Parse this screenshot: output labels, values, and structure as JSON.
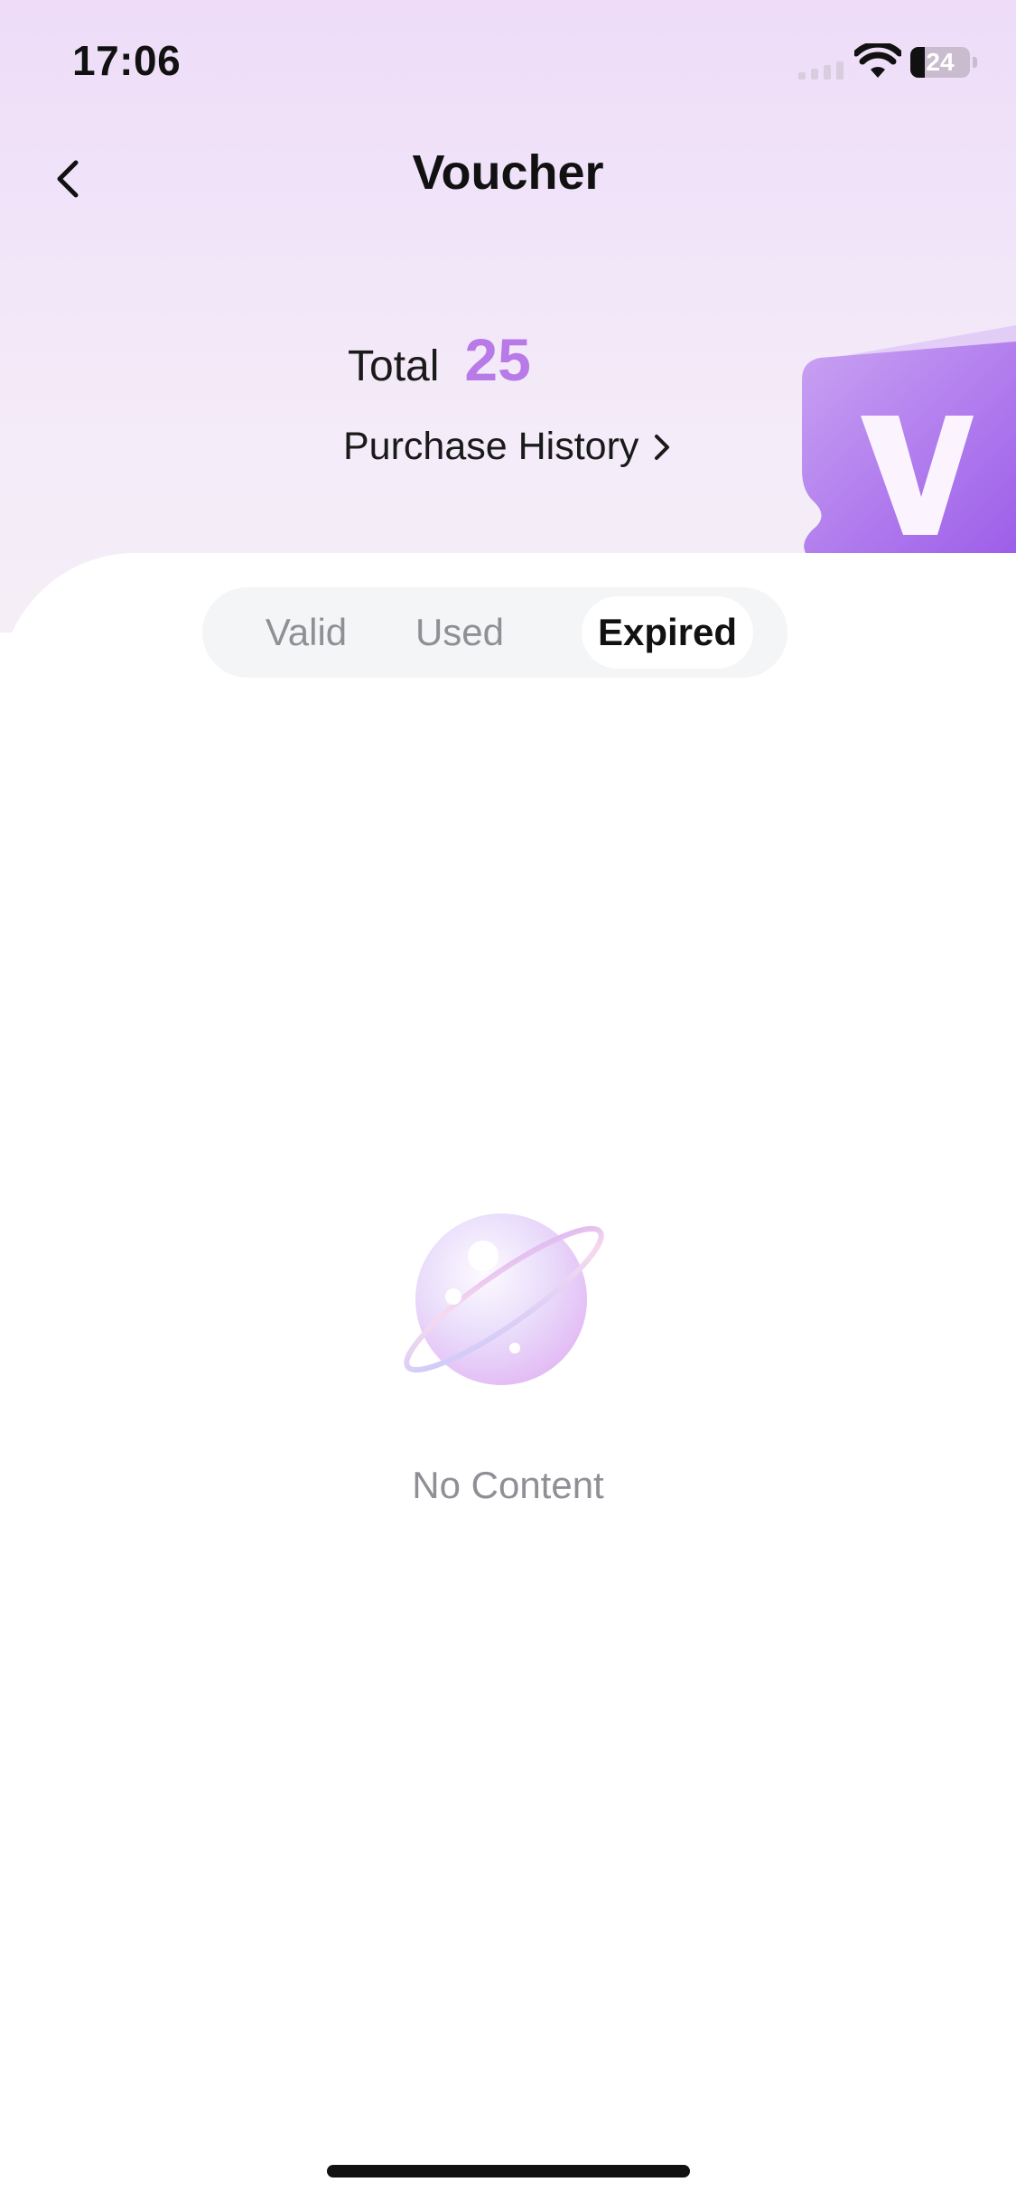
{
  "status_bar": {
    "time": "17:06",
    "battery_level": "24",
    "battery_fraction": 0.24,
    "signal_icon": "cellular-signal-icon",
    "wifi_icon": "wifi-icon"
  },
  "nav": {
    "title": "Voucher",
    "back_icon": "chevron-left-icon"
  },
  "summary": {
    "total_label": "Total",
    "total_value": "25",
    "purchase_history_label": "Purchase History",
    "link_icon": "chevron-right-icon"
  },
  "tabs": [
    {
      "label": "Valid",
      "active": false
    },
    {
      "label": "Used",
      "active": false
    },
    {
      "label": "Expired",
      "active": true
    }
  ],
  "empty_state": {
    "text": "No Content",
    "icon": "planet-icon"
  },
  "colors": {
    "accent": "#b77ae6",
    "header_bg": "#efe0f8",
    "tab_bg": "#f4f5f7",
    "muted_text": "#8f8f95"
  }
}
